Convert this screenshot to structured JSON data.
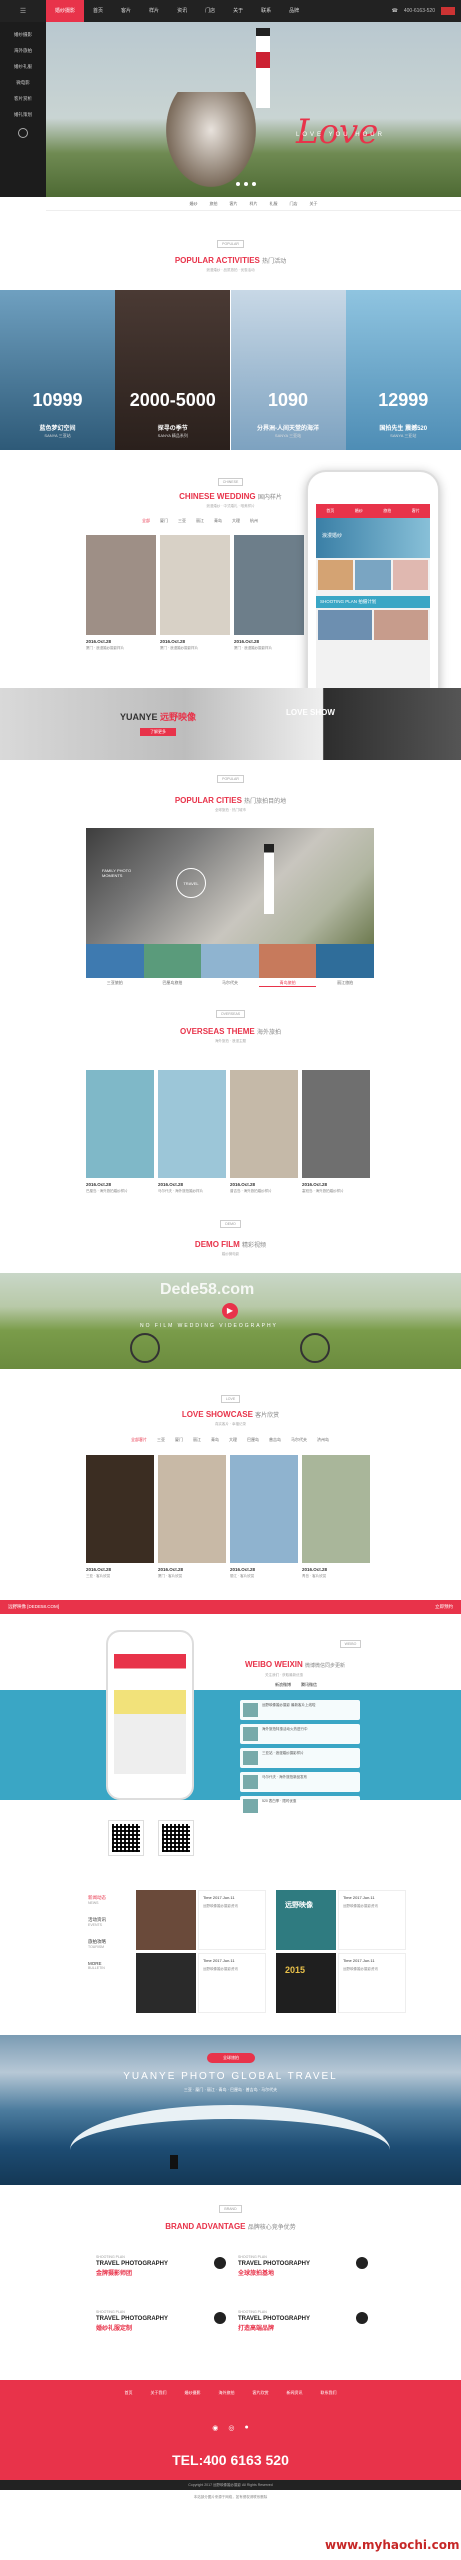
{
  "topbar": {
    "home_icon": "home-icon",
    "nav": [
      "婚纱摄影",
      "首页",
      "客片",
      "样片",
      "资讯",
      "门店",
      "关于",
      "联系",
      "品牌"
    ],
    "active_index": 0,
    "hotline": "400-6163-520"
  },
  "sidebar": {
    "items": [
      "婚纱摄影",
      "海外旅拍",
      "婚纱礼服",
      "微电影",
      "客片赏析",
      "婚礼策划"
    ],
    "logo_icon": "circle-logo-icon"
  },
  "hero": {
    "script": "Love",
    "sub": "LOVE YOU HOUR"
  },
  "iconrow": [
    "婚纱",
    "旅拍",
    "客片",
    "样片",
    "礼服",
    "门店",
    "关于"
  ],
  "popular_activities": {
    "tag": "POPULAR",
    "title_en": "POPULAR ACTIVITIES",
    "title_cn": "热门活动",
    "sub": "浪漫婚纱 · 品质旅拍 · 优惠活动",
    "items": [
      {
        "price": "10999",
        "title": "蓝色梦幻空间",
        "sub": "SANYA 三亚站"
      },
      {
        "price": "2000-5000",
        "title": "探寻の季节",
        "sub": "SANYA 精品系列"
      },
      {
        "price": "1090",
        "title": "分界洲-人间天堂的海洋",
        "sub": "SANYA 三亚站"
      },
      {
        "price": "12999",
        "title": "国拍先生 震撼520",
        "sub": "SANYA 三亚站"
      }
    ]
  },
  "chinese_wedding": {
    "tag": "CHINESE",
    "title_en": "CHINESE WEDDING",
    "title_cn": "国内样片",
    "sub": "浪漫婚纱 · 中式婚礼 · 唯美样片",
    "tabs": [
      "全部",
      "厦门",
      "三亚",
      "丽江",
      "青岛",
      "大理",
      "杭州"
    ],
    "cards": [
      {
        "date": "2016.Oct.28",
        "text": "厦门 · 浪漫婚纱摄影样片"
      },
      {
        "date": "2016.Oct.28",
        "text": "厦门 · 浪漫婚纱摄影样片"
      },
      {
        "date": "2016.Oct.28",
        "text": "厦门 · 浪漫婚纱摄影样片"
      }
    ]
  },
  "phone": {
    "menu": [
      "首页",
      "婚纱",
      "旅拍",
      "客片"
    ],
    "banner_text": "浪漫婚纱",
    "plan_label": "SHOOTING PLAN",
    "plan_cn": "拍摄计划"
  },
  "yuanye": {
    "brand_en": "YUANYE",
    "brand_cn": "远野映像",
    "button": "了解更多",
    "right_text": "LOVE SHOW"
  },
  "popular_cities": {
    "tag": "POPULAR",
    "title_en": "POPULAR CITIES",
    "title_cn": "热门旅拍目的地",
    "sub": "全球旅拍 · 热门城市",
    "circle_text": "TRAVEL",
    "left_text": "FAMILY PHOTO MOMENTS",
    "labels": [
      "三亚旅拍",
      "巴厘岛旅拍",
      "马尔代夫",
      "青岛旅拍",
      "丽江旅拍"
    ],
    "active_index": 3
  },
  "overseas": {
    "tag": "OVERSEAS",
    "title_en": "OVERSEAS THEME",
    "title_cn": "海外旅拍",
    "sub": "海外旅拍 · 浪漫主题",
    "cards": [
      {
        "date": "2016.Oct.28",
        "text": "巴厘岛 · 海外旅拍婚纱样片"
      },
      {
        "date": "2016.Oct.28",
        "text": "马尔代夫 · 海外旅拍婚纱样片"
      },
      {
        "date": "2016.Oct.28",
        "text": "普吉岛 · 海外旅拍婚纱样片"
      },
      {
        "date": "2016.Oct.28",
        "text": "塞班岛 · 海外旅拍婚纱样片"
      }
    ]
  },
  "demo_film": {
    "tag": "DEMO",
    "title_en": "DEMO FILM",
    "title_cn": "精彩视频",
    "sub": "婚纱微电影",
    "watermark": "Dede58.com",
    "overlay": "NO FILM WEDDING VIDEOGRAPHY",
    "play_icon": "play-icon"
  },
  "love_showcase": {
    "tag": "LOVE",
    "title_en": "LOVE SHOWCASE",
    "title_cn": "客片欣赏",
    "sub": "真实客片 · 幸福记录",
    "tabs": [
      "全部客片",
      "三亚",
      "厦门",
      "丽江",
      "青岛",
      "大理",
      "巴厘岛",
      "普吉岛",
      "马尔代夫",
      "济州岛"
    ],
    "cards": [
      {
        "date": "2016.Oct.28",
        "text": "三亚 · 客片欣赏"
      },
      {
        "date": "2016.Oct.28",
        "text": "厦门 · 客片欣赏"
      },
      {
        "date": "2016.Oct.28",
        "text": "丽江 · 客片欣赏"
      },
      {
        "date": "2016.Oct.28",
        "text": "青岛 · 客片欣赏"
      }
    ]
  },
  "promo_bar": {
    "left": "远野映像  [DEDE58.COM]",
    "right": "立即预约"
  },
  "weibo": {
    "tag": "WEIBO",
    "title_en": "WEIBO WEIXIN",
    "title_cn": "微博微信同步更新",
    "sub": "关注我们 · 获取最新优惠",
    "tabs": [
      "新浪微博",
      "腾讯微信"
    ],
    "messages": [
      "远野映像婚纱摄影 最新客片上线啦",
      "海外旅拍特惠活动火热进行中",
      "三亚站 · 浪漫婚纱摄影样片",
      "马尔代夫 · 海外旅拍新品发布",
      "520 表白季 · 限时优惠"
    ]
  },
  "news": {
    "side": [
      {
        "cn": "新闻动态",
        "en": "NEWS"
      },
      {
        "cn": "活动资讯",
        "en": "EVENTS"
      },
      {
        "cn": "旅拍攻略",
        "en": "TOURISM"
      },
      {
        "cn": "MORE",
        "en": "BULLETIN"
      }
    ],
    "items": [
      {
        "date": "Time 2017.Jun.11",
        "text": "远野映像婚纱摄影资讯"
      },
      {
        "date": "Time 2017.Jun.11",
        "text": "远野映像婚纱摄影资讯"
      },
      {
        "date": "Time 2017.Jun.11",
        "text": "远野映像婚纱摄影资讯"
      },
      {
        "date": "Time 2017.Jun.11",
        "text": "远野映像婚纱摄影资讯"
      }
    ],
    "badge": "远野映像",
    "year": "2015"
  },
  "travel": {
    "pill": "全球旅拍",
    "title": "YUANYE PHOTO GLOBAL TRAVEL",
    "sub": "三亚 · 厦门 · 丽江 · 青岛 · 巴厘岛 · 普吉岛 · 马尔代夫"
  },
  "brand_advantage": {
    "tag": "BRAND",
    "title_en": "BRAND ADVANTAGE",
    "title_cn": "品牌核心竞争优势",
    "items": [
      {
        "s": "SHOOTING PLAN",
        "h": "TRAVEL PHOTOGRAPHY",
        "c": "金牌摄影师团"
      },
      {
        "s": "SHOOTING PLAN",
        "h": "TRAVEL PHOTOGRAPHY",
        "c": "全球旅拍基地"
      },
      {
        "s": "SHOOTING PLAN",
        "h": "TRAVEL PHOTOGRAPHY",
        "c": "婚纱礼服定制"
      },
      {
        "s": "SHOOTING PLAN",
        "h": "TRAVEL PHOTOGRAPHY",
        "c": "打造高端品牌"
      }
    ]
  },
  "footer": {
    "links": [
      "首页",
      "关于我们",
      "婚纱摄影",
      "海外旅拍",
      "客片欣赏",
      "新闻资讯",
      "联系我们"
    ],
    "social": [
      "wechat-icon",
      "weibo-icon",
      "qq-icon"
    ],
    "tel": "TEL:400 6163 520",
    "copyright": "Copyright 2017 远野映像婚纱摄影 All Rights Reserved",
    "copyright2": "本站部分图片来源于网络，如有侵权请联系删除"
  },
  "site_watermark": "www.myhaochi.com",
  "colors": {
    "accent": "#e8334a",
    "dark": "#222222",
    "blue": "#3aa6c5"
  }
}
